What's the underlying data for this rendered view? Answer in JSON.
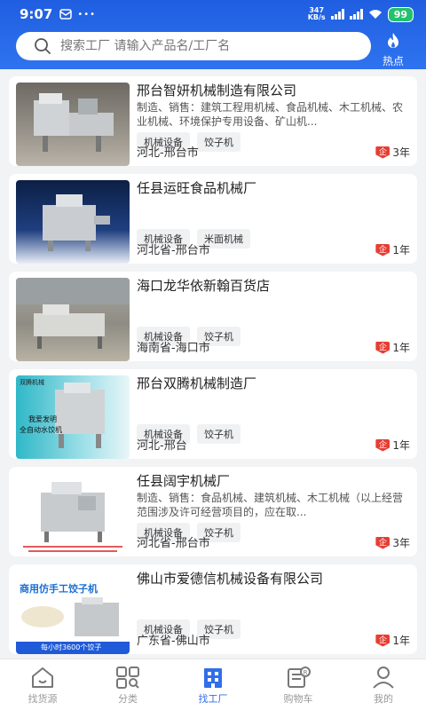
{
  "status": {
    "time": "9:07",
    "speed_top": "347",
    "speed_bottom": "KB/s",
    "battery": "99"
  },
  "search": {
    "placeholder": "搜索工厂 请输入产品名/工厂名"
  },
  "hot": {
    "label": "热点"
  },
  "factories": [
    {
      "name": "邢台智妍机械制造有限公司",
      "desc": "制造、销售：建筑工程用机械、食品机械、木工机械、农业机械、环境保护专用设备、矿山机...",
      "tags": [
        "机械设备",
        "饺子机"
      ],
      "location": "河北-邢台市",
      "years": "3年"
    },
    {
      "name": "任县运旺食品机械厂",
      "desc": "",
      "tags": [
        "机械设备",
        "米面机械"
      ],
      "location": "河北省-邢台市",
      "years": "1年"
    },
    {
      "name": "海口龙华依新翰百货店",
      "desc": "",
      "tags": [
        "机械设备",
        "饺子机"
      ],
      "location": "海南省-海口市",
      "years": "1年"
    },
    {
      "name": "邢台双腾机械制造厂",
      "desc": "",
      "tags": [
        "机械设备",
        "饺子机"
      ],
      "location": "河北-邢台",
      "years": "1年"
    },
    {
      "name": "任县阔宇机械厂",
      "desc": "制造、销售：食品机械、建筑机械、木工机械（以上经营范围涉及许可经营项目的，应在取...",
      "tags": [
        "机械设备",
        "饺子机"
      ],
      "location": "河北省-邢台市",
      "years": "3年"
    },
    {
      "name": "佛山市爱德信机械设备有限公司",
      "desc": "",
      "tags": [
        "机械设备",
        "饺子机"
      ],
      "location": "广东省-佛山市",
      "years": "1年"
    }
  ],
  "thumb_text": {
    "card4_brand": "双腾机械",
    "card4_line1": "我爱发明",
    "card4_line2": "全自动水饺机",
    "card6_title": "商用仿手工饺子机",
    "card6_bottom": "每小时3600个饺子"
  },
  "qiye_mark": "企",
  "tabs": [
    {
      "label": "找货源",
      "icon": "house-icon",
      "active": false
    },
    {
      "label": "分类",
      "icon": "category-grid-icon",
      "active": false
    },
    {
      "label": "找工厂",
      "icon": "factory-building-icon",
      "active": true
    },
    {
      "label": "购物车",
      "icon": "cart-list-icon",
      "active": false
    },
    {
      "label": "我的",
      "icon": "user-icon",
      "active": false
    }
  ],
  "colors": {
    "brand_blue": "#2f6fe8",
    "badge_red": "#e63d33"
  }
}
